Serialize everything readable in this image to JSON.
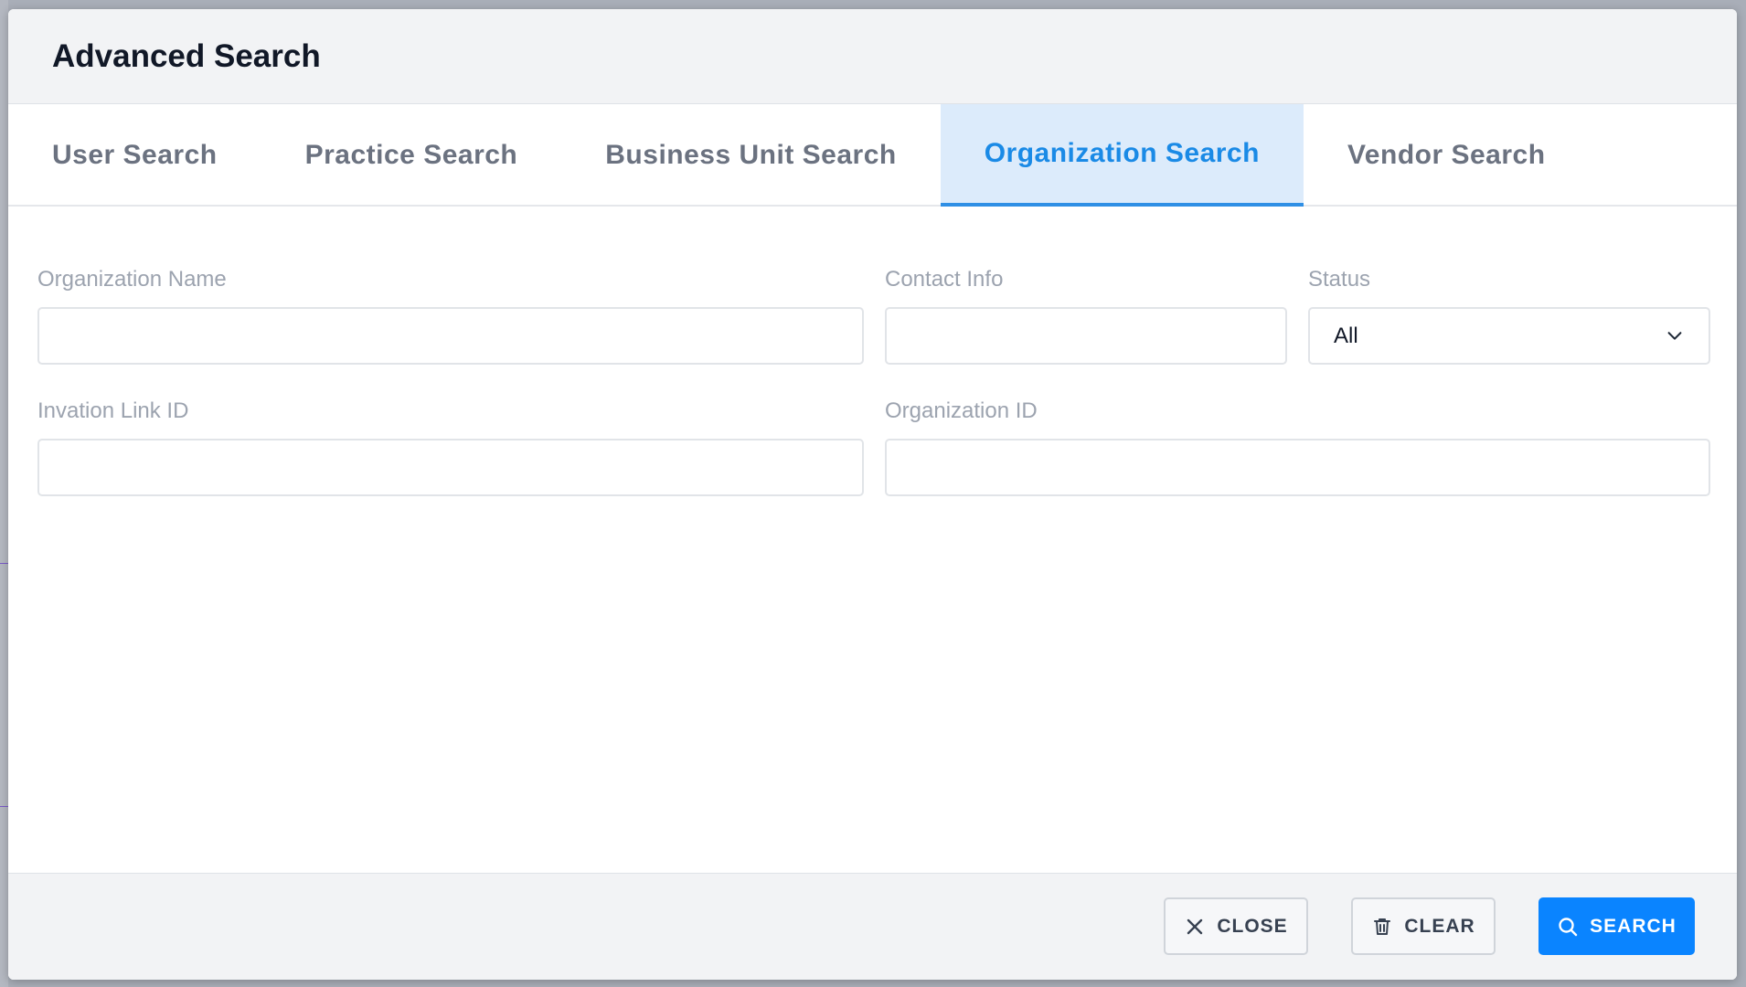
{
  "modal": {
    "title": "Advanced Search"
  },
  "tabs": [
    {
      "label": "User Search",
      "active": false
    },
    {
      "label": "Practice Search",
      "active": false
    },
    {
      "label": "Business Unit Search",
      "active": false
    },
    {
      "label": "Organization Search",
      "active": true
    },
    {
      "label": "Vendor Search",
      "active": false
    }
  ],
  "form": {
    "organization_name": {
      "label": "Organization Name",
      "value": ""
    },
    "contact_info": {
      "label": "Contact Info",
      "value": ""
    },
    "status": {
      "label": "Status",
      "value": "All",
      "icon": "chevron-down-icon"
    },
    "invitation_link_id": {
      "label": "Invation Link ID",
      "value": ""
    },
    "organization_id": {
      "label": "Organization ID",
      "value": ""
    }
  },
  "footer": {
    "close": {
      "label": "CLOSE",
      "icon": "close-icon"
    },
    "clear": {
      "label": "CLEAR",
      "icon": "trash-icon"
    },
    "search": {
      "label": "SEARCH",
      "icon": "search-icon"
    }
  },
  "colors": {
    "accent": "#0a84ff",
    "active_tab_bg": "#dcebfb",
    "active_tab_text": "#1a8ae6"
  }
}
